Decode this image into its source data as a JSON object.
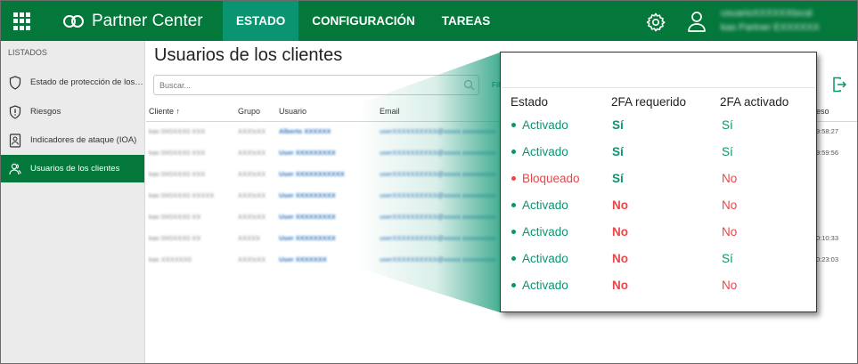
{
  "topbar": {
    "brand": "Partner Center",
    "nav": [
      {
        "label": "ESTADO",
        "active": true
      },
      {
        "label": "CONFIGURACIÓN",
        "active": false
      },
      {
        "label": "TAREAS",
        "active": false
      }
    ],
    "account_line1": "usuarioXXXXXXlocal",
    "account_line2": "kas Partner EXXXXXX"
  },
  "sidebar": {
    "heading": "LISTADOS",
    "items": [
      {
        "label": "Estado de protección de los clie...",
        "icon": "shield-icon"
      },
      {
        "label": "Riesgos",
        "icon": "shield-alert-icon"
      },
      {
        "label": "Indicadores de ataque (IOA)",
        "icon": "id-badge-icon"
      },
      {
        "label": "Usuarios de los clientes",
        "icon": "users-icon",
        "active": true
      }
    ]
  },
  "main": {
    "title": "Usuarios de los clientes",
    "search_placeholder": "Buscar...",
    "filter_label": "Fil"
  },
  "table": {
    "headers": {
      "client": "Cliente ↑",
      "group": "Grupo",
      "user": "Usuario",
      "email": "Email",
      "last": "eso"
    },
    "rows": [
      {
        "client": "kas 0X0XXX0 XXX",
        "group": "XXX\\nXX",
        "user": "Alberto XXXXXX",
        "email": "userXXXXXXXXXX@xxxxx.xxxxxxxxxx",
        "time": "9:58:27"
      },
      {
        "client": "kas 0X0XXX0 XXX",
        "group": "XXX\\nXX",
        "user": "User XXXXXXXXX",
        "email": "userXXXXXXXXXX@xxxxx.xxxxxxxxxx",
        "time": "9:59:56"
      },
      {
        "client": "kas 0X0XXX0 XXX",
        "group": "XXX\\nXX",
        "user": "User XXXXXXXXXXX",
        "email": "userXXXXXXXXXX@xxxxx.xxxxxxxxxx",
        "time": ""
      },
      {
        "client": "kas 0X0XXX0 XXXXX",
        "group": "XXX\\nXX",
        "user": "User XXXXXXXXX",
        "email": "userXXXXXXXXXX@xxxxx.xxxxxxxxxx",
        "time": ""
      },
      {
        "client": "kas 0X0XXX0 XX",
        "group": "XXX\\nXX",
        "user": "User XXXXXXXXX",
        "email": "userXXXXXXXXXX@xxxxx.xxxxxxxxxx",
        "time": ""
      },
      {
        "client": "kas 0X0XXX0 XX",
        "group": "XXXXX",
        "user": "User XXXXXXXXX",
        "email": "userXXXXXXXXXX@xxxxx.xxxxxxxxxx",
        "time": "0:10:33"
      },
      {
        "client": "kas XXXXXX0",
        "group": "XXX\\nXX",
        "user": "User XXXXXXX",
        "email": "userXXXXXXXXXX@xxxxx.xxxxxxxxxx",
        "time": "0:23:03"
      }
    ]
  },
  "zoom": {
    "headers": {
      "estado": "Estado",
      "req": "2FA requerido",
      "act": "2FA activado"
    },
    "rows": [
      {
        "estado": "Activado",
        "estado_color": "green",
        "req": "Sí",
        "act": "Sí",
        "act_color": "green"
      },
      {
        "estado": "Activado",
        "estado_color": "green",
        "req": "Sí",
        "act": "Sí",
        "act_color": "green"
      },
      {
        "estado": "Bloqueado",
        "estado_color": "red",
        "req": "Sí",
        "act": "No",
        "act_color": "red"
      },
      {
        "estado": "Activado",
        "estado_color": "green",
        "req": "No",
        "act": "No",
        "act_color": "red"
      },
      {
        "estado": "Activado",
        "estado_color": "green",
        "req": "No",
        "act": "No",
        "act_color": "red"
      },
      {
        "estado": "Activado",
        "estado_color": "green",
        "req": "No",
        "act": "Sí",
        "act_color": "green"
      },
      {
        "estado": "Activado",
        "estado_color": "green",
        "req": "No",
        "act": "No",
        "act_color": "red"
      }
    ]
  },
  "colors": {
    "brand_green": "#04773b",
    "accent_teal": "#0a9470",
    "danger_red": "#e8464a"
  }
}
